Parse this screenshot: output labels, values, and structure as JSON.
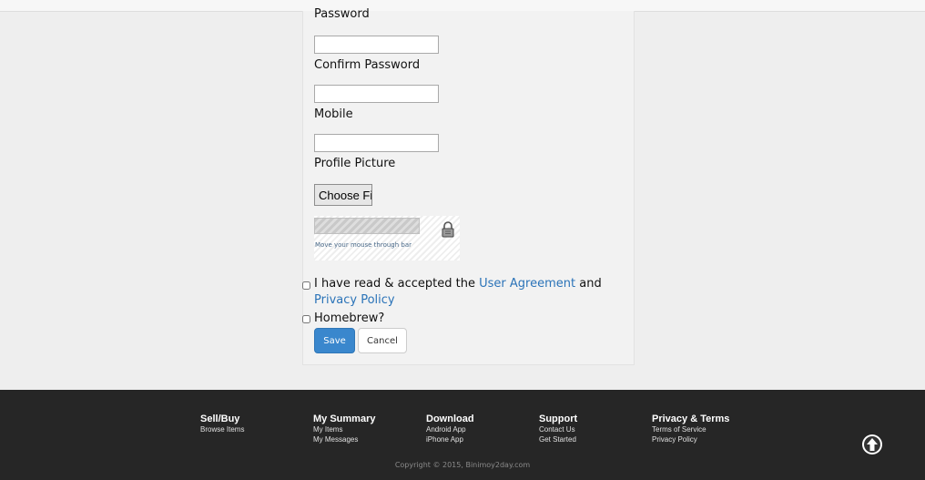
{
  "form": {
    "password_label": "Password",
    "confirm_password_label": "Confirm Password",
    "mobile_label": "Mobile",
    "profile_picture_label": "Profile Picture",
    "file_button_label": "Choose File",
    "captcha_hint": "Move your mouse through bar",
    "agreement_prefix": "I have read & accepted the ",
    "user_agreement_link": "User Agreement",
    "agreement_and": " and ",
    "privacy_policy_link": "Privacy Policy",
    "homebrew_label": "Homebrew?",
    "save_label": "Save",
    "cancel_label": "Cancel"
  },
  "footer": {
    "columns": [
      {
        "heading": "Sell/Buy",
        "links": [
          "Browse Items"
        ]
      },
      {
        "heading": "My Summary",
        "links": [
          "My Items",
          "My Messages"
        ]
      },
      {
        "heading": "Download",
        "links": [
          "Android App",
          "iPhone App"
        ]
      },
      {
        "heading": "Support",
        "links": [
          "Contact Us",
          "Get Started"
        ]
      },
      {
        "heading": "Privacy & Terms",
        "links": [
          "Terms of Service",
          "Privacy Policy"
        ]
      }
    ],
    "copyright": "Copyright © 2015, Binimoy2day.com"
  },
  "colors": {
    "link": "#2a73b8",
    "primary_button": "#3a87cd",
    "footer_bg": "#262626"
  },
  "icons": {
    "captcha_lock": "lock-icon",
    "back_to_top": "arrow-up-circle-icon"
  }
}
